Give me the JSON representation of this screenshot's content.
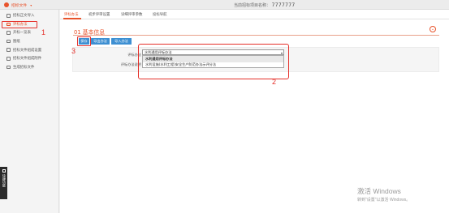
{
  "topbar": {
    "app_menu_label": "招标文件",
    "project_label": "当前招标项目名称：",
    "project_name": "7777777"
  },
  "sidebar": {
    "items": [
      {
        "label": "招标正文导入",
        "active": false
      },
      {
        "label": "评标办法",
        "active": true
      },
      {
        "label": "开标一览表",
        "active": false
      },
      {
        "label": "图纸",
        "active": false
      },
      {
        "label": "招标文件组成设置",
        "active": false
      },
      {
        "label": "招标文件组成附件",
        "active": false
      },
      {
        "label": "生成招标文件",
        "active": false
      }
    ],
    "quick_tab_label": "快捷功能"
  },
  "tabs": [
    "评标办法",
    "初步评审设置",
    "详细评审参数",
    "投标导航"
  ],
  "section": {
    "title": "01 基本信息"
  },
  "buttons": {
    "save": "保存",
    "export": "导出办法",
    "import": "导入办法"
  },
  "form": {
    "method_label": "评标办法",
    "desc_label": "评标办法说明",
    "selected_value": "水利通用评标办法",
    "options": [
      "水利通用评标办法",
      "水利设施(水利工程)安全生产防范办法示评分法"
    ]
  },
  "annotations": {
    "one": "1",
    "two": "2",
    "three": "3"
  },
  "watermark": {
    "title": "激活 Windows",
    "subtitle": "转到\"设置\"以激活 Windows。"
  }
}
